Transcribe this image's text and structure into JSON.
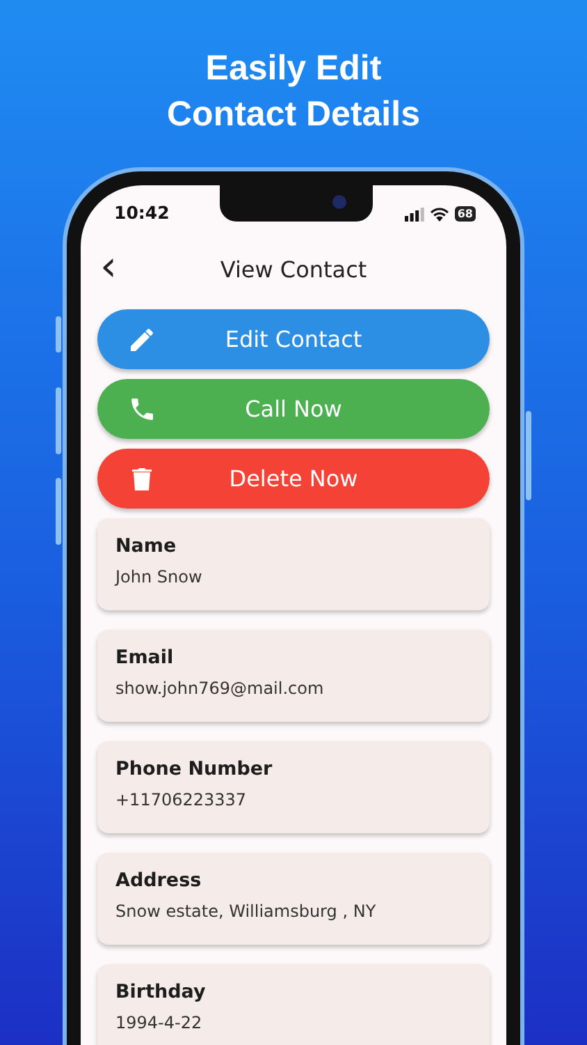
{
  "headline": [
    "Easily Edit",
    "Contact Details"
  ],
  "status_bar": {
    "time": "10:42",
    "battery": "68"
  },
  "header": {
    "back": "‹",
    "title": "View Contact"
  },
  "actions": [
    {
      "kind": "edit",
      "label": "Edit Contact"
    },
    {
      "kind": "call",
      "label": "Call Now"
    },
    {
      "kind": "delete",
      "label": "Delete Now"
    }
  ],
  "fields": [
    {
      "label": "Name",
      "value": "John Snow"
    },
    {
      "label": "Email",
      "value": "show.john769@mail.com"
    },
    {
      "label": "Phone Number",
      "value": "+11706223337"
    },
    {
      "label": "Address",
      "value": "Snow estate, Williamsburg , NY"
    },
    {
      "label": "Birthday",
      "value": "1994-4-22"
    }
  ]
}
